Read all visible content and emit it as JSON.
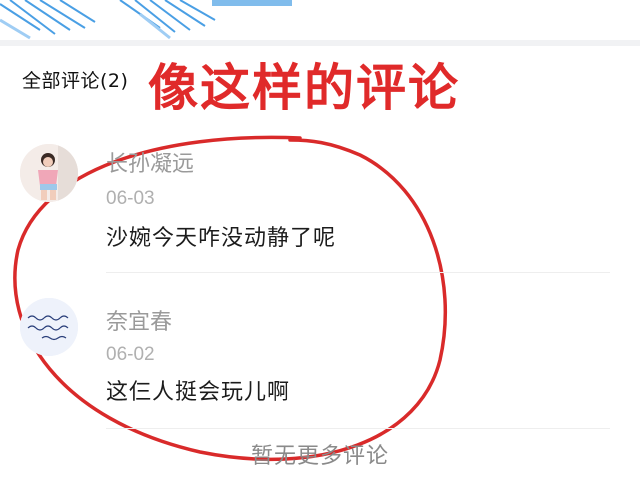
{
  "header": {
    "banner_text": "",
    "colors": {
      "accent": "#2b8fe0",
      "accent_light": "#9fcdf4"
    }
  },
  "comments_section": {
    "title": "全部评论(2)",
    "empty_footer": "暂无更多评论"
  },
  "overlay": {
    "caption": "像这样的评论",
    "color": "#e02a2a"
  },
  "comments": [
    {
      "author": "长孙凝远",
      "date": "06-03",
      "text": "沙婉今天咋没动静了呢",
      "avatar": "photo-avatar-girl"
    },
    {
      "author": "奈宜春",
      "date": "06-02",
      "text": "这仨人挺会玩儿啊",
      "avatar": "handwriting-avatar"
    }
  ]
}
